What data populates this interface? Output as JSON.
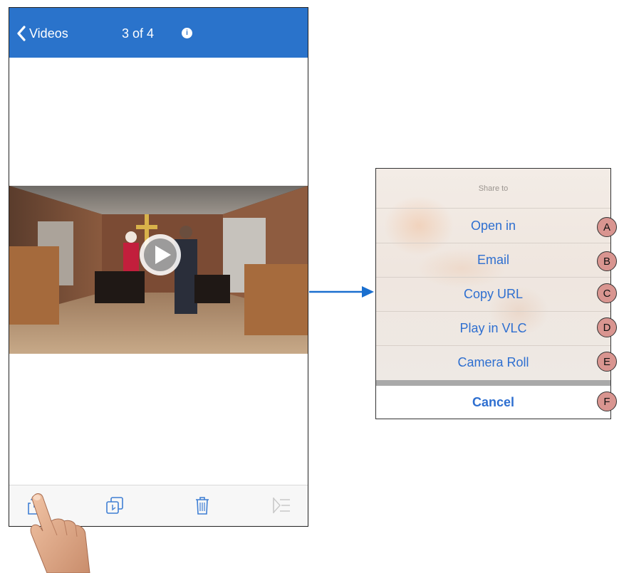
{
  "navbar": {
    "back_label": "Videos",
    "count": "3 of 4",
    "info_icon": "i"
  },
  "colors": {
    "navbar_bg": "#2a73cb",
    "action_text": "#2e6fd0",
    "arrow": "#1a6fcf",
    "marker_bg": "#d99590"
  },
  "icons": {
    "back": "chevron-left-icon",
    "info": "info-icon",
    "play": "play-icon",
    "share": "share-icon",
    "copy": "copy-icon",
    "trash": "trash-icon",
    "list": "list-icon"
  },
  "share_sheet": {
    "title": "Share to",
    "items": [
      {
        "label": "Open in",
        "marker": "A"
      },
      {
        "label": "Email",
        "marker": "B"
      },
      {
        "label": "Copy URL",
        "marker": "C"
      },
      {
        "label": "Play in VLC",
        "marker": "D"
      },
      {
        "label": "Camera Roll",
        "marker": "E"
      }
    ],
    "cancel": {
      "label": "Cancel",
      "marker": "F"
    }
  }
}
